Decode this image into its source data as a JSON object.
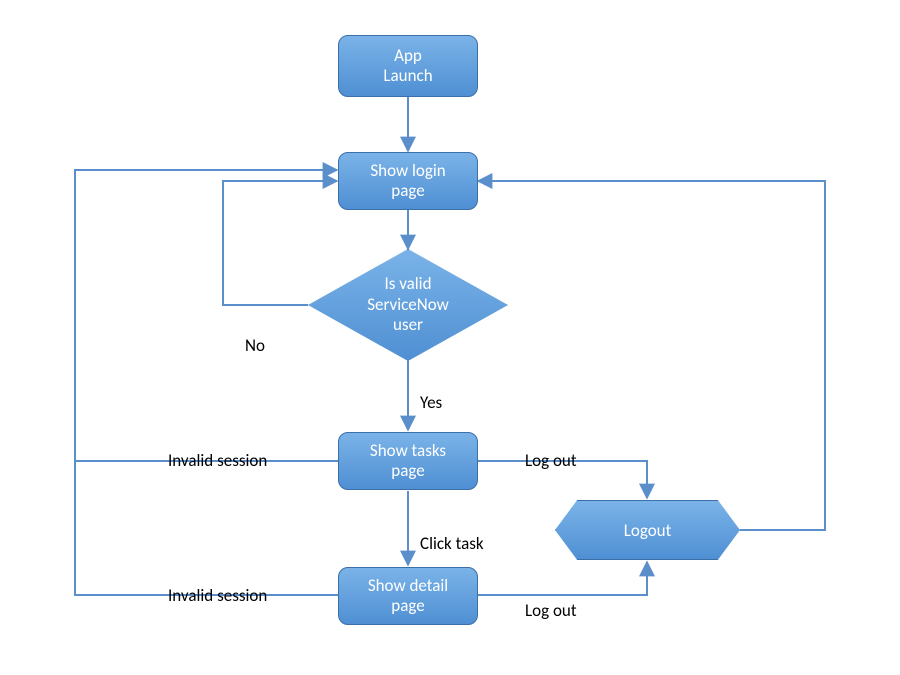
{
  "nodes": {
    "app_launch": "App\nLaunch",
    "show_login": "Show login\npage",
    "is_valid_user": "Is valid\nServiceNow\nuser",
    "show_tasks": "Show tasks\npage",
    "show_detail": "Show detail\npage",
    "logout": "Logout"
  },
  "labels": {
    "no": "No",
    "yes": "Yes",
    "invalid_session_tasks": "Invalid session",
    "invalid_session_detail": "Invalid session",
    "click_task": "Click task",
    "logout_tasks": "Log out",
    "logout_detail": "Log out"
  },
  "colors": {
    "node_top": "#7ab3e8",
    "node_bottom": "#4f8fd3",
    "border": "#3a6fa8",
    "arrow": "#5a8fcb",
    "text_dark": "#000000",
    "text_light": "#ffffff"
  }
}
